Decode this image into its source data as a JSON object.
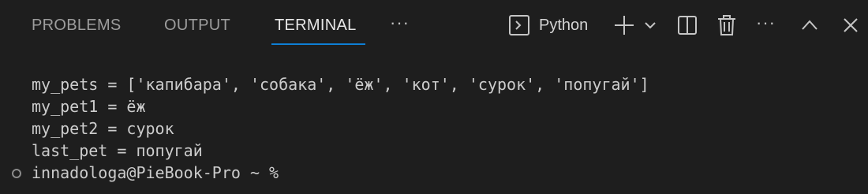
{
  "tabs": [
    {
      "label": "PROBLEMS",
      "active": false
    },
    {
      "label": "OUTPUT",
      "active": false
    },
    {
      "label": "TERMINAL",
      "active": true
    }
  ],
  "tab_more": "···",
  "toolbar": {
    "shell_icon": "terminal-shell-icon",
    "shell_label": "Python",
    "new_terminal_icon": "plus-icon",
    "dropdown_icon": "chevron-down-icon",
    "split_icon": "split-editor-icon",
    "kill_icon": "trash-icon",
    "more_icon": "ellipsis-icon",
    "maximize_icon": "chevron-up-icon",
    "close_icon": "close-icon",
    "more_label": "···"
  },
  "terminal": {
    "lines": [
      "my_pets = ['капибара', 'собака', 'ёж', 'кот', 'сурок', 'попугай']",
      "my_pet1 = ёж",
      "my_pet2 = сурок",
      "last_pet = попугай",
      "innadologa@PieBook-Pro ~ %"
    ]
  },
  "colors": {
    "background": "#1e1e1e",
    "active_tab_underline": "#0e7fd5",
    "inactive_tab_text": "#9d9d9d",
    "active_tab_text": "#e7e7e7",
    "terminal_text": "#cccccc"
  }
}
